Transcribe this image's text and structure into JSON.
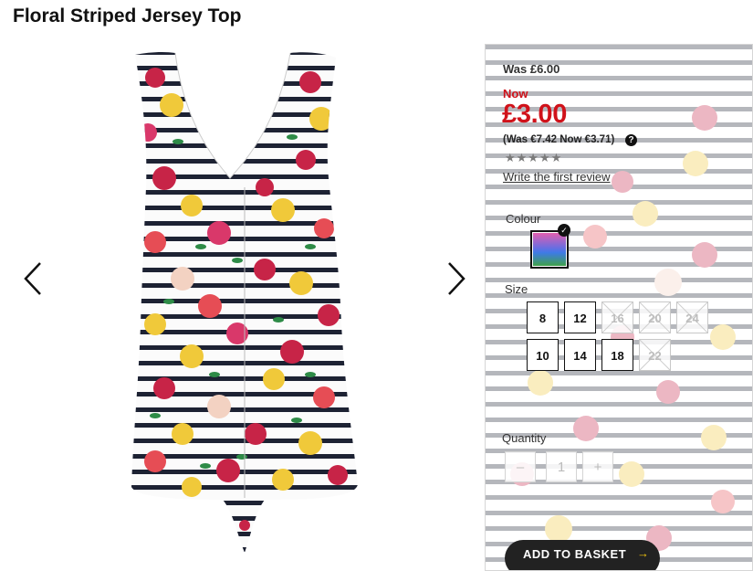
{
  "product": {
    "title": "Floral Striped Jersey Top"
  },
  "colors": {
    "accent_red": "#d0121a",
    "button_dark": "#222222",
    "arrow_yellow": "#f1c40f"
  },
  "icons": {
    "prev": "chevron-left-icon",
    "next": "chevron-right-icon",
    "help": "question-circle-icon",
    "check": "check-badge-icon",
    "basket_arrow": "arrow-right-icon"
  },
  "pricing": {
    "was": "Was £6.00",
    "now_label": "Now",
    "now_price": "£3.00",
    "euro": "(Was €7.42 Now €3.71)",
    "help_glyph": "?"
  },
  "rating": {
    "stars": "★★★★★",
    "review_link": "Write the first review"
  },
  "colour": {
    "label": "Colour",
    "selected_check": "✓"
  },
  "size": {
    "label": "Size",
    "options": [
      {
        "value": "8",
        "available": true
      },
      {
        "value": "12",
        "available": true
      },
      {
        "value": "16",
        "available": false
      },
      {
        "value": "20",
        "available": false
      },
      {
        "value": "24",
        "available": false
      },
      {
        "value": "10",
        "available": true
      },
      {
        "value": "14",
        "available": true
      },
      {
        "value": "18",
        "available": true
      },
      {
        "value": "22",
        "available": false
      }
    ]
  },
  "quantity": {
    "label": "Quantity",
    "minus": "–",
    "value": "1",
    "plus": "+"
  },
  "basket": {
    "label": "ADD TO BASKET",
    "arrow": "→"
  }
}
